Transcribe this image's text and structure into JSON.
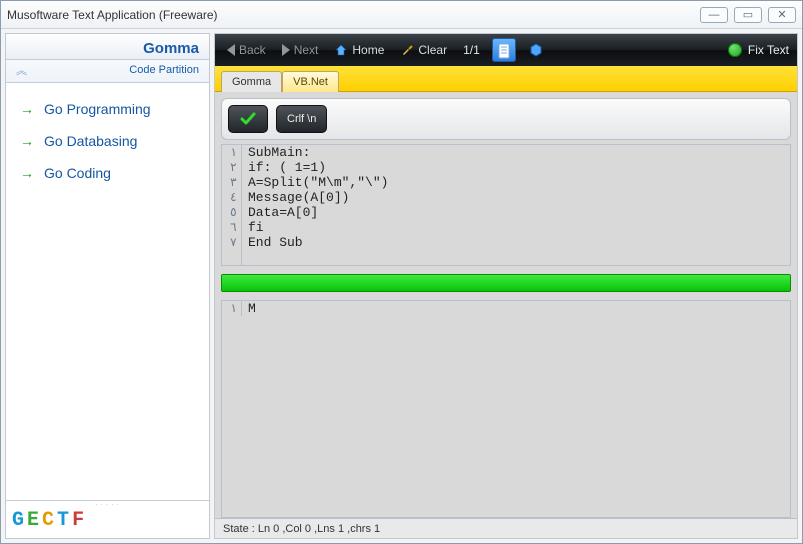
{
  "window": {
    "title": "Musoftware Text Application (Freeware)"
  },
  "sidebar": {
    "header": "Gomma",
    "subheader": "Code Partition",
    "items": [
      {
        "label": "Go Programming"
      },
      {
        "label": "Go Databasing"
      },
      {
        "label": "Go Coding"
      }
    ],
    "logo": {
      "g": "G",
      "e": "E",
      "c": "C",
      "t": "T",
      "f": "F"
    }
  },
  "toolbar": {
    "back": "Back",
    "next": "Next",
    "home": "Home",
    "clear": "Clear",
    "counter": "1/1",
    "fixtext": "Fix Text"
  },
  "tabs": [
    {
      "label": "Gomma",
      "active": true
    },
    {
      "label": "VB.Net",
      "active": false
    }
  ],
  "panel": {
    "crlf": "Crlf \\n"
  },
  "gutter_digits": [
    "١",
    "٢",
    "٣",
    "٤",
    "٥",
    "٦",
    "٧"
  ],
  "code_lines": [
    "SubMain:",
    "if: ( 1=1)",
    "A=Split(\"M\\m\",\"\\\")",
    "Message(A[0])",
    "Data=A[0]",
    "fi",
    "End Sub"
  ],
  "output": {
    "gutter": "١",
    "text": "M"
  },
  "status": "State :  Ln 0 ,Col 0 ,Lns 1 ,chrs 1"
}
